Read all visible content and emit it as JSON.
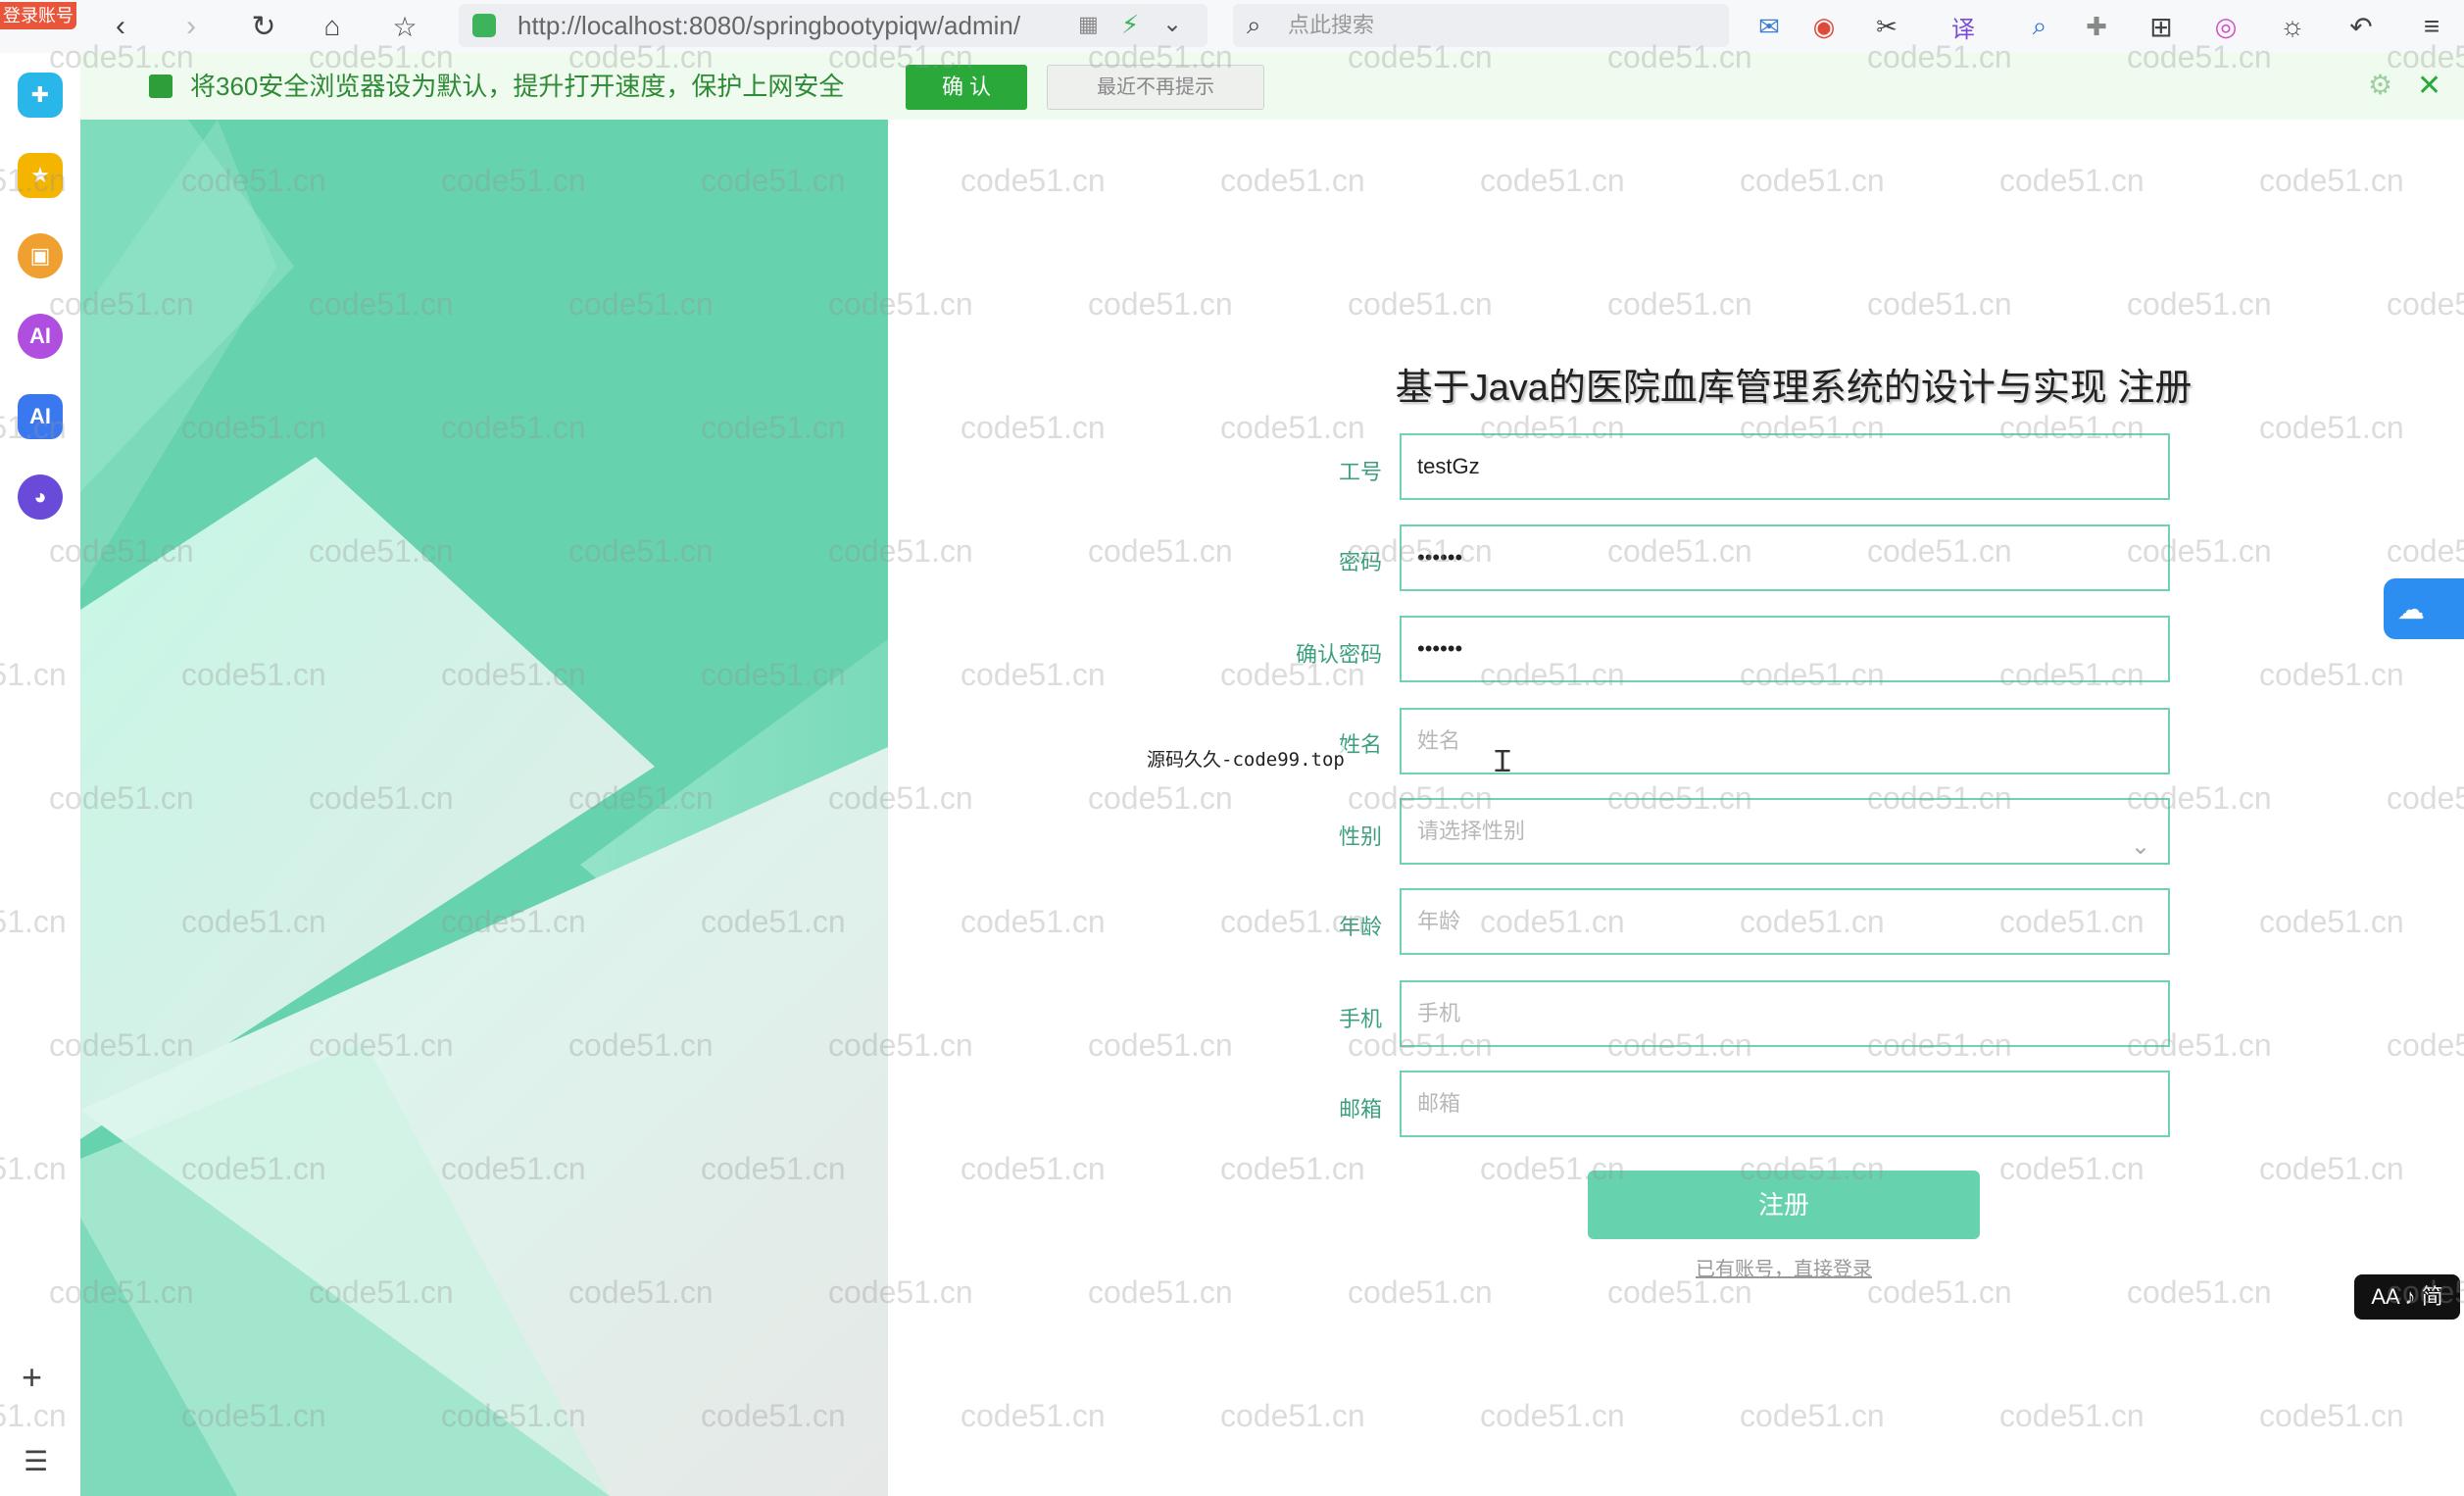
{
  "browser": {
    "login_tag": "登录账号",
    "url": "http://localhost:8080/springbootypiqw/admin/",
    "search_placeholder": "点此搜索"
  },
  "notification": {
    "text": "将360安全浏览器设为默认，提升打开速度，保护上网安全",
    "confirm_label": "确 认",
    "dismiss_label": "最近不再提示"
  },
  "watermark": "code51.cn",
  "form": {
    "title": "基于Java的医院血库管理系统的设计与实现 注册",
    "fields": [
      {
        "label": "工号",
        "value": "testGz",
        "placeholder": ""
      },
      {
        "label": "密码",
        "value": "••••••",
        "placeholder": ""
      },
      {
        "label": "确认密码",
        "value": "••••••",
        "placeholder": ""
      },
      {
        "label": "姓名",
        "value": "",
        "placeholder": "姓名"
      },
      {
        "label": "性别",
        "value": "",
        "placeholder": "请选择性别"
      },
      {
        "label": "年龄",
        "value": "",
        "placeholder": "年龄"
      },
      {
        "label": "手机",
        "value": "",
        "placeholder": "手机"
      },
      {
        "label": "邮箱",
        "value": "",
        "placeholder": "邮箱"
      }
    ],
    "submit_label": "注册",
    "login_link": "已有账号，直接登录"
  },
  "source_tag": "源码久久-code99.top",
  "aa_badge": "AA ♪ 简",
  "colors": {
    "accent": "#66d2ae",
    "label": "#3c9f7f",
    "notif_green": "#2aa839"
  }
}
